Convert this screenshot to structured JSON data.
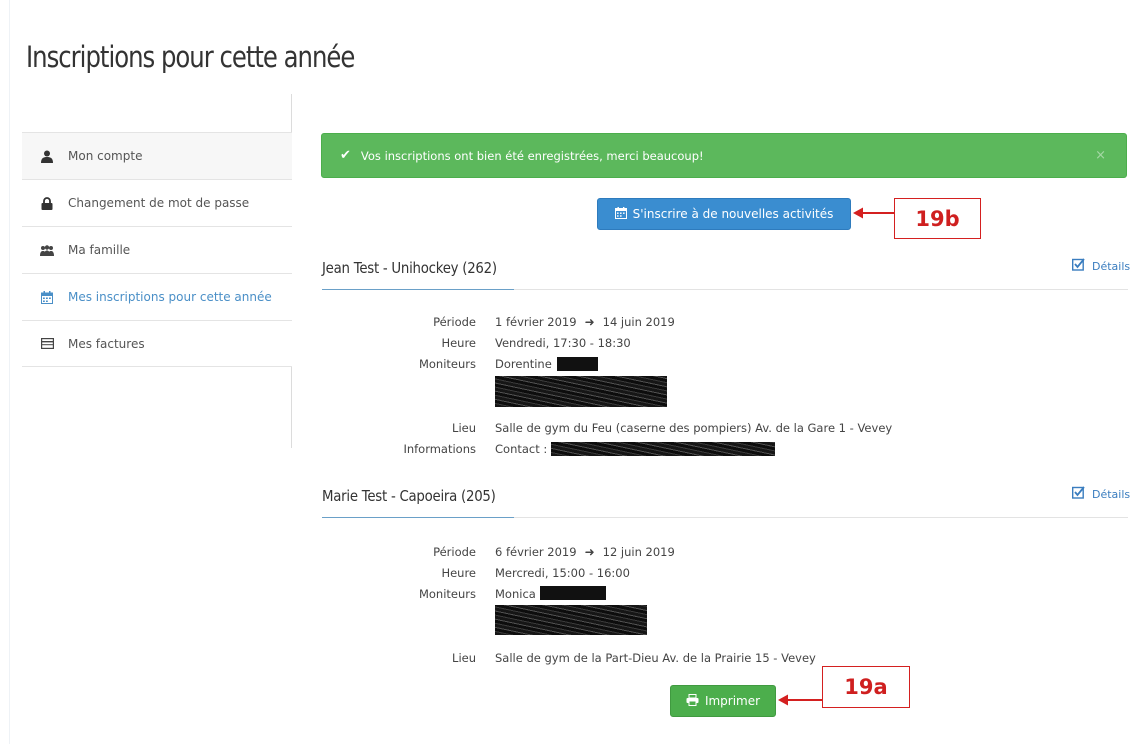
{
  "page": {
    "title": "Inscriptions pour cette année"
  },
  "sidebar": {
    "items": [
      {
        "label": "Mon compte",
        "icon": "user-icon"
      },
      {
        "label": "Changement de mot de passe",
        "icon": "lock-icon"
      },
      {
        "label": "Ma famille",
        "icon": "family-icon"
      },
      {
        "label": "Mes inscriptions pour cette année",
        "icon": "calendar-icon",
        "active": true
      },
      {
        "label": "Mes factures",
        "icon": "invoice-icon"
      }
    ]
  },
  "alert": {
    "text": "Vos inscriptions ont bien été enregistrées, merci beaucoup!",
    "close": "×",
    "color": "#5cb85c"
  },
  "actions": {
    "new_activities_label": "S'inscrire à de nouvelles activités",
    "print_label": "Imprimer"
  },
  "callouts": {
    "new": "19b",
    "print": "19a"
  },
  "registrations": [
    {
      "title": "Jean Test - Unihockey (262)",
      "details_label": "Détails",
      "labels": {
        "period": "Période",
        "time": "Heure",
        "instructors": "Moniteurs",
        "place": "Lieu",
        "info": "Informations"
      },
      "period_start": "1 février 2019",
      "period_end": "14 juin 2019",
      "time": "Vendredi, 17:30 - 18:30",
      "instructor": "Dorentine",
      "place": "Salle de gym du Feu (caserne des pompiers) Av. de la Gare 1 - Vevey",
      "info": "Contact :"
    },
    {
      "title": "Marie Test - Capoeira (205)",
      "details_label": "Détails",
      "labels": {
        "period": "Période",
        "time": "Heure",
        "instructors": "Moniteurs",
        "place": "Lieu"
      },
      "period_start": "6 février 2019",
      "period_end": "12 juin 2019",
      "time": "Mercredi, 15:00 - 16:00",
      "instructor": "Monica",
      "place": "Salle de gym de la Part-Dieu Av. de la Prairie 15 - Vevey"
    }
  ],
  "colors": {
    "primary": "#3a8dd0",
    "success": "#4cae4c",
    "annotation": "#d42020",
    "link": "#3a7dbf"
  }
}
